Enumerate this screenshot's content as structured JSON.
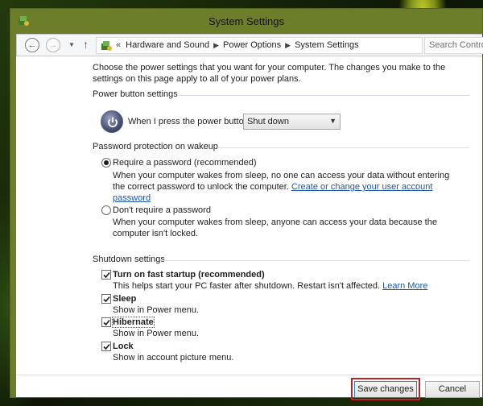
{
  "window": {
    "title": "System Settings"
  },
  "nav": {
    "back_icon": "back-arrow-icon",
    "forward_icon": "forward-arrow-icon",
    "breadcrumb_prefix": "«",
    "breadcrumbs": [
      "Hardware and Sound",
      "Power Options",
      "System Settings"
    ],
    "search_placeholder": "Search Control Pa"
  },
  "intro": "Choose the power settings that you want for your computer. The changes you make to the settings on this page apply to all of your power plans.",
  "power_button": {
    "section": "Power button settings",
    "label": "When I press the power button:",
    "selected": "Shut down"
  },
  "password": {
    "section": "Password protection on wakeup",
    "require_label": "Require a password (recommended)",
    "require_desc": "When your computer wakes from sleep, no one can access your data without entering the correct password to unlock the computer.",
    "require_link": "Create or change your user account password",
    "require_selected": true,
    "no_label": "Don't require a password",
    "no_desc": "When your computer wakes from sleep, anyone can access your data because the computer isn't locked."
  },
  "shutdown": {
    "section": "Shutdown settings",
    "items": [
      {
        "label": "Turn on fast startup (recommended)",
        "desc": "This helps start your PC faster after shutdown. Restart isn't affected.",
        "link": "Learn More",
        "checked": true
      },
      {
        "label": "Sleep",
        "desc": "Show in Power menu.",
        "checked": true
      },
      {
        "label": "Hibernate",
        "desc": "Show in Power menu.",
        "checked": true
      },
      {
        "label": "Lock",
        "desc": "Show in account picture menu.",
        "checked": true
      }
    ]
  },
  "buttons": {
    "save": "Save changes",
    "cancel": "Cancel"
  },
  "colors": {
    "link": "#1b57a6",
    "highlight": "#c0222a"
  }
}
